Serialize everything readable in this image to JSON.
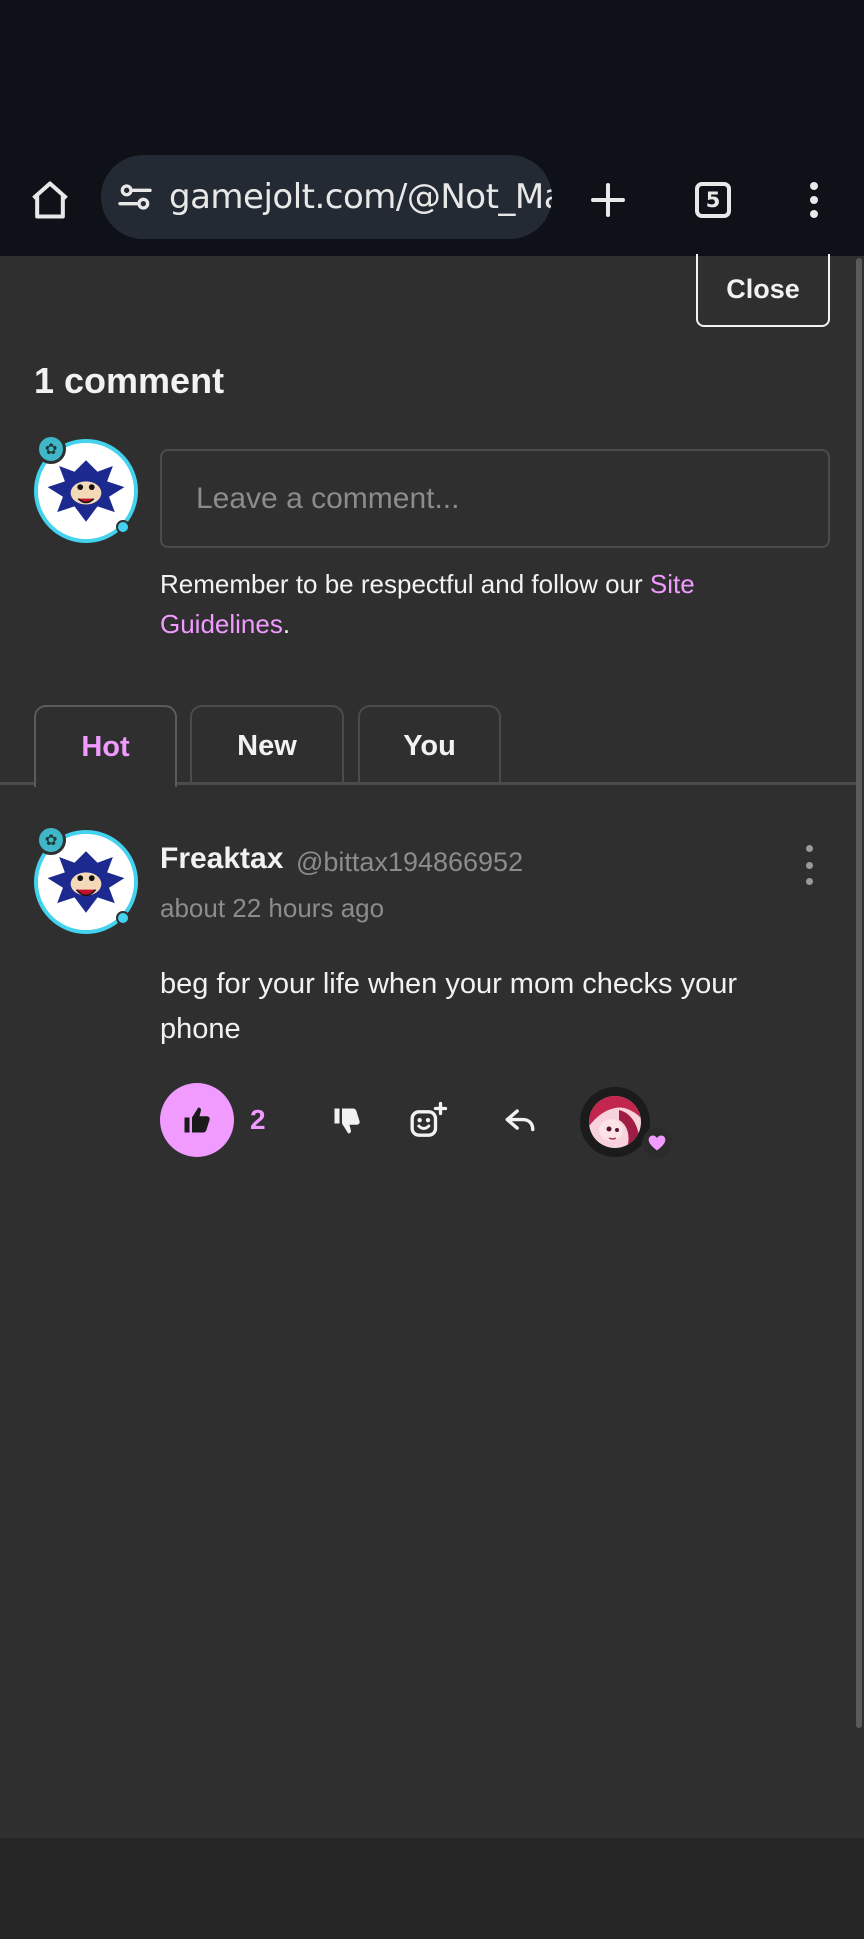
{
  "browser": {
    "url": "gamejolt.com/@Not_Ma",
    "tab_count": "5"
  },
  "modal": {
    "close_label": "Close",
    "comment_count_label": "1 comment",
    "input_placeholder": "Leave a comment...",
    "guidelines": {
      "prefix": "Remember to be respectful and follow our ",
      "link": "Site Guidelines",
      "suffix": "."
    },
    "sort_tabs": [
      {
        "label": "Hot",
        "active": true
      },
      {
        "label": "New",
        "active": false
      },
      {
        "label": "You",
        "active": false
      }
    ]
  },
  "comment": {
    "author": "Freaktax",
    "handle": "@bittax194866952",
    "timestamp": "about 22 hours ago",
    "body": "beg for your life when your mom checks your phone",
    "like_count": "2",
    "liked": true
  },
  "colors": {
    "accent": "#f19aff",
    "background": "#2f2f2f",
    "browser_bar": "#0e1117",
    "avatar_ring": "#43d3ee"
  },
  "icons": {
    "home": "home-icon",
    "site_settings": "tune-icon",
    "new_tab": "plus-icon",
    "tabs": "tab-switcher-icon",
    "browser_menu": "more-vertical-icon",
    "like": "thumbs-up-icon",
    "dislike": "thumbs-down-icon",
    "react": "add-reaction-icon",
    "reply": "reply-icon",
    "comment_menu": "more-vertical-icon",
    "heart": "heart-icon"
  }
}
